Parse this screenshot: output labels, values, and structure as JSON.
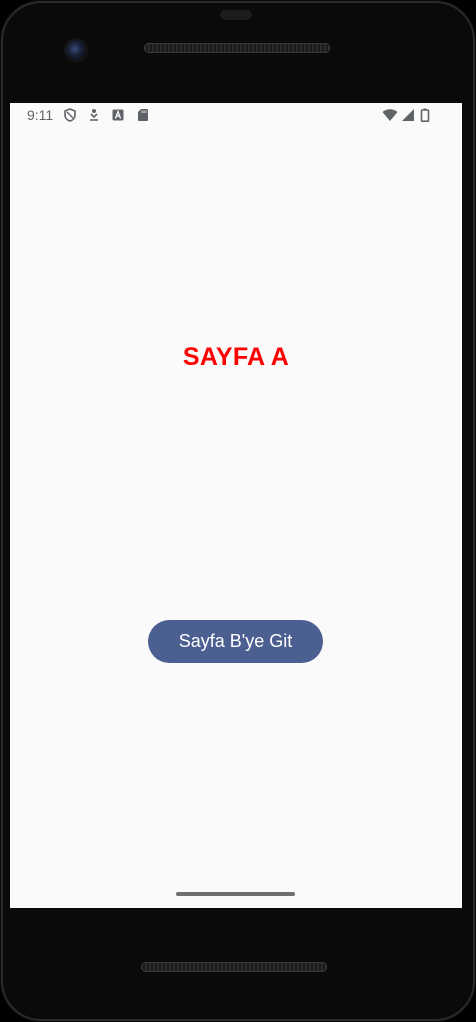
{
  "status_bar": {
    "time": "9:11",
    "left_icons": [
      "shield-icon",
      "download-icon",
      "font-icon",
      "sd-card-icon"
    ],
    "right_icons": [
      "wifi-icon",
      "cell-signal-icon",
      "battery-icon"
    ]
  },
  "page": {
    "title": "SAYFA A",
    "title_color": "#ff0000",
    "button_label": "Sayfa B'ye Git",
    "button_color": "#4b5f91"
  }
}
